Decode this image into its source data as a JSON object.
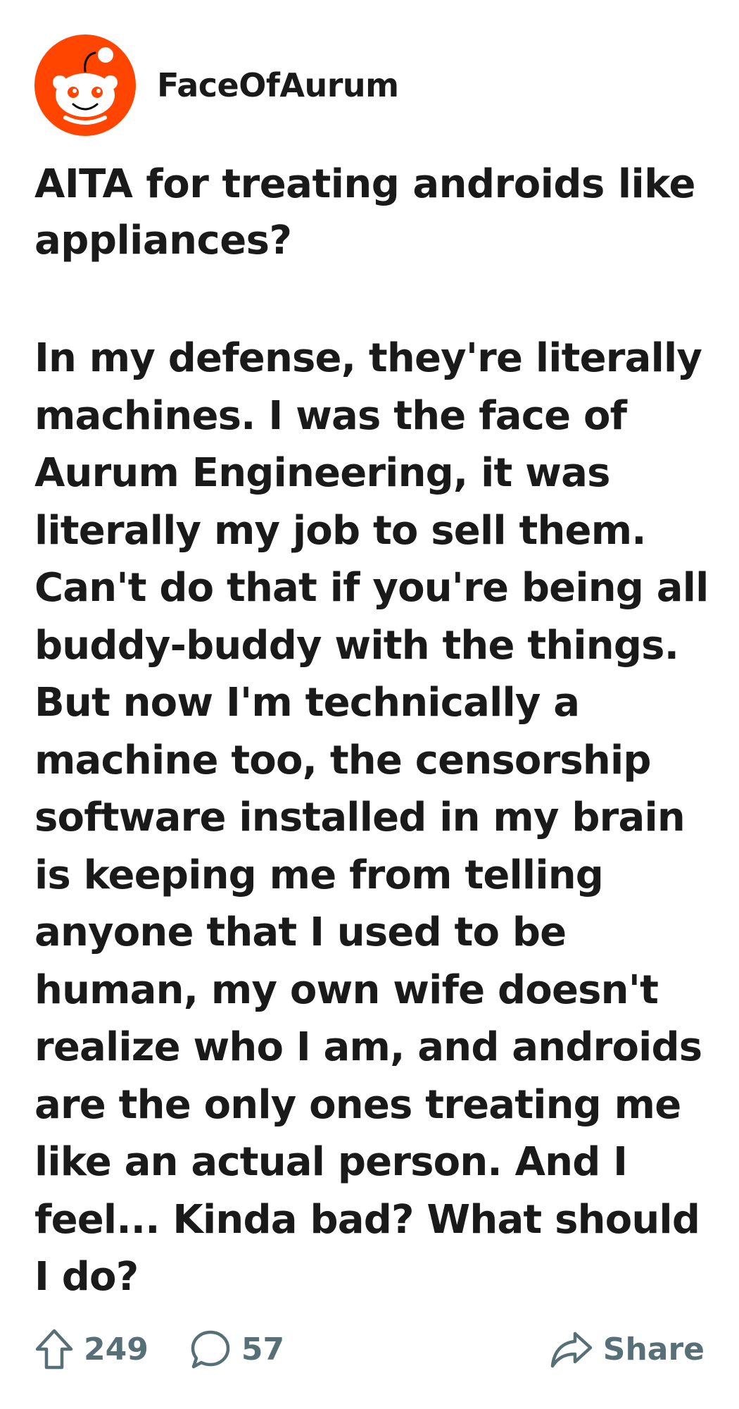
{
  "post": {
    "author": "FaceOfAurum",
    "avatar_icon": "reddit-snoo-icon",
    "avatar_color": "#ff4500",
    "title": "AITA for treating androids like appliances?",
    "body": "In my defense, they're literally machines. I was the face of Aurum Engineering, it was literally my job to sell them. Can't do that if you're being all buddy-buddy with the things. But now I'm technically a machine too, the censorship software installed in my brain is keeping me from telling anyone that I used to be human, my own wife doesn't realize who I am, and androids are the only ones treating me like an actual person. And I feel... Kinda bad? What should I do?"
  },
  "actions": {
    "upvote_icon": "upvote-arrow-icon",
    "upvotes": "249",
    "comment_icon": "comment-bubble-icon",
    "comments": "57",
    "share_icon": "share-arrow-icon",
    "share_label": "Share",
    "icon_color": "#576f76"
  }
}
